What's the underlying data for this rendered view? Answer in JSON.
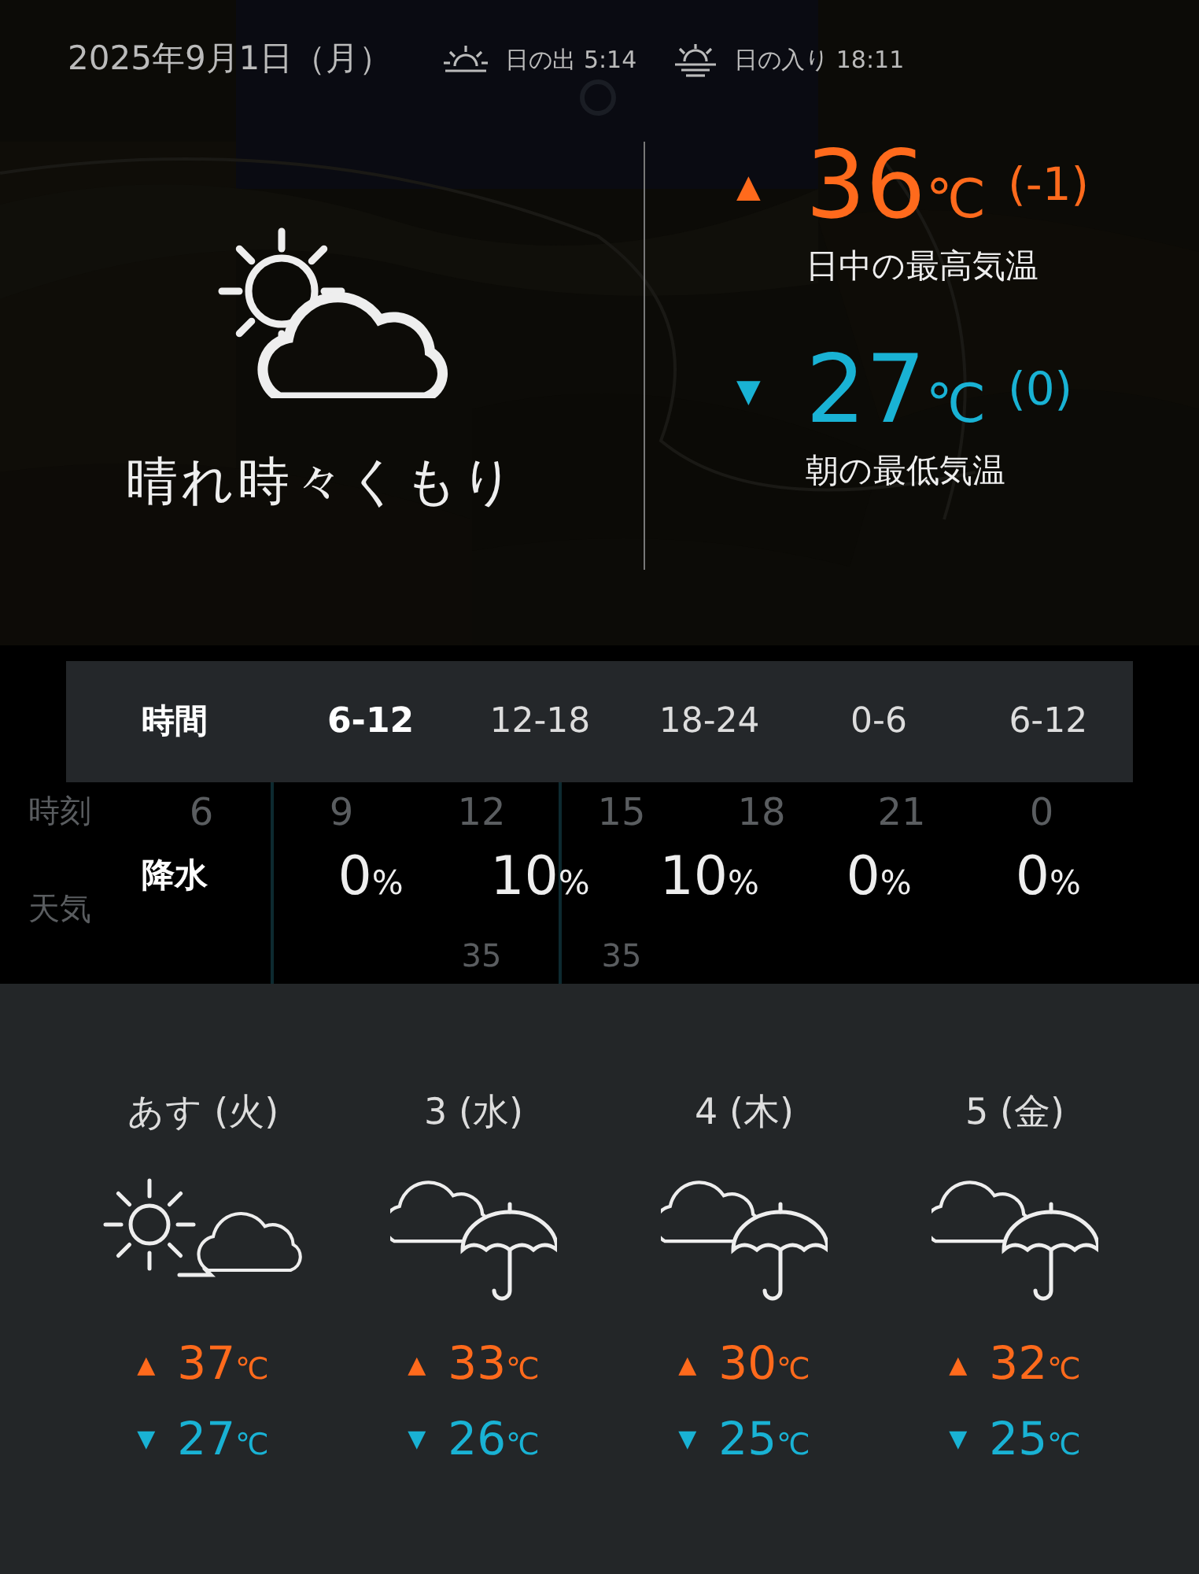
{
  "header": {
    "date": "2025年9月1日（月）",
    "sunrise": "日の出 5:14",
    "sunset": "日の入り 18:11"
  },
  "today": {
    "weather": {
      "kind": "sun_cloud",
      "label": "晴れ時々くもり"
    },
    "high": {
      "arrow": "▲",
      "value": "36",
      "unit": "℃",
      "diff": "(-1)",
      "label": "日中の最高気温"
    },
    "low": {
      "arrow": "▼",
      "value": "27",
      "unit": "℃",
      "diff": "(0)",
      "label": "朝の最低気温"
    }
  },
  "background_timeline": {
    "row_labels": [
      "時刻",
      "天気"
    ],
    "hours": [
      {
        "hour": "6"
      },
      {
        "hour": "9"
      },
      {
        "hour": "12",
        "temp": "35"
      },
      {
        "hour": "15",
        "temp": "35"
      },
      {
        "hour": "18"
      },
      {
        "hour": "21"
      },
      {
        "hour": "0"
      }
    ]
  },
  "precipitation": {
    "header_label": "時間",
    "row_label": "降水",
    "periods": [
      {
        "label": "6-12",
        "selected": true,
        "value": "0",
        "unit": "%"
      },
      {
        "label": "12-18",
        "selected": false,
        "value": "10",
        "unit": "%"
      },
      {
        "label": "18-24",
        "selected": false,
        "value": "10",
        "unit": "%"
      },
      {
        "label": "0-6",
        "selected": false,
        "value": "0",
        "unit": "%"
      },
      {
        "label": "6-12",
        "selected": false,
        "value": "0",
        "unit": "%"
      }
    ]
  },
  "forecast": [
    {
      "day": "あす (火)",
      "kind": "sun_then_cloud",
      "high_arrow": "▲",
      "high": "37",
      "low_arrow": "▼",
      "low": "27",
      "unit": "℃"
    },
    {
      "day": "3 (水)",
      "kind": "cloud_umbrella",
      "high_arrow": "▲",
      "high": "33",
      "low_arrow": "▼",
      "low": "26",
      "unit": "℃"
    },
    {
      "day": "4 (木)",
      "kind": "cloud_umbrella",
      "high_arrow": "▲",
      "high": "30",
      "low_arrow": "▼",
      "low": "25",
      "unit": "℃"
    },
    {
      "day": "5 (金)",
      "kind": "cloud_umbrella",
      "high_arrow": "▲",
      "high": "32",
      "low_arrow": "▼",
      "low": "25",
      "unit": "℃"
    }
  ]
}
